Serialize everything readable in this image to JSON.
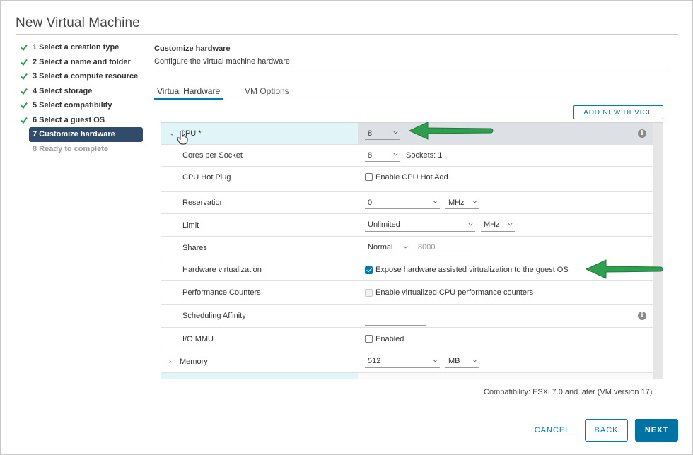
{
  "window": {
    "title": "New Virtual Machine"
  },
  "steps": [
    {
      "label": "1 Select a creation type",
      "state": "done"
    },
    {
      "label": "2 Select a name and folder",
      "state": "done"
    },
    {
      "label": "3 Select a compute resource",
      "state": "done"
    },
    {
      "label": "4 Select storage",
      "state": "done"
    },
    {
      "label": "5 Select compatibility",
      "state": "done"
    },
    {
      "label": "6 Select a guest OS",
      "state": "done"
    },
    {
      "label": "7 Customize hardware",
      "state": "active"
    },
    {
      "label": "8 Ready to complete",
      "state": "disabled"
    }
  ],
  "content": {
    "title": "Customize hardware",
    "subtitle": "Configure the virtual machine hardware"
  },
  "tabs": [
    {
      "label": "Virtual Hardware",
      "active": true
    },
    {
      "label": "VM Options",
      "active": false
    }
  ],
  "add_device_label": "ADD NEW DEVICE",
  "hardware": {
    "cpu": {
      "label": "CPU *",
      "value": "8"
    },
    "cores_per_socket": {
      "label": "Cores per Socket",
      "value": "8",
      "sockets": "Sockets: 1"
    },
    "cpu_hot_plug": {
      "label": "CPU Hot Plug",
      "option": "Enable CPU Hot Add",
      "checked": false
    },
    "reservation": {
      "label": "Reservation",
      "value": "0",
      "unit": "MHz"
    },
    "limit": {
      "label": "Limit",
      "value": "Unlimited",
      "unit": "MHz"
    },
    "shares": {
      "label": "Shares",
      "value": "Normal",
      "amount": "8000"
    },
    "hw_virt": {
      "label": "Hardware virtualization",
      "option": "Expose hardware assisted virtualization to the guest OS",
      "checked": true
    },
    "perf_counters": {
      "label": "Performance Counters",
      "option": "Enable virtualized CPU performance counters",
      "checked": false,
      "disabled": true
    },
    "sched_affinity": {
      "label": "Scheduling Affinity",
      "value": ""
    },
    "iommu": {
      "label": "I/O MMU",
      "option": "Enabled",
      "checked": false
    },
    "memory": {
      "label": "Memory",
      "value": "512",
      "unit": "MB"
    }
  },
  "compatibility": "Compatibility: ESXi 7.0 and later (VM version 17)",
  "buttons": {
    "cancel": "CANCEL",
    "back": "BACK",
    "next": "NEXT"
  },
  "colors": {
    "accent": "#0079b8",
    "active_step": "#314c6b",
    "arrow": "#2e9e4f",
    "check": "#2e9e4f"
  }
}
